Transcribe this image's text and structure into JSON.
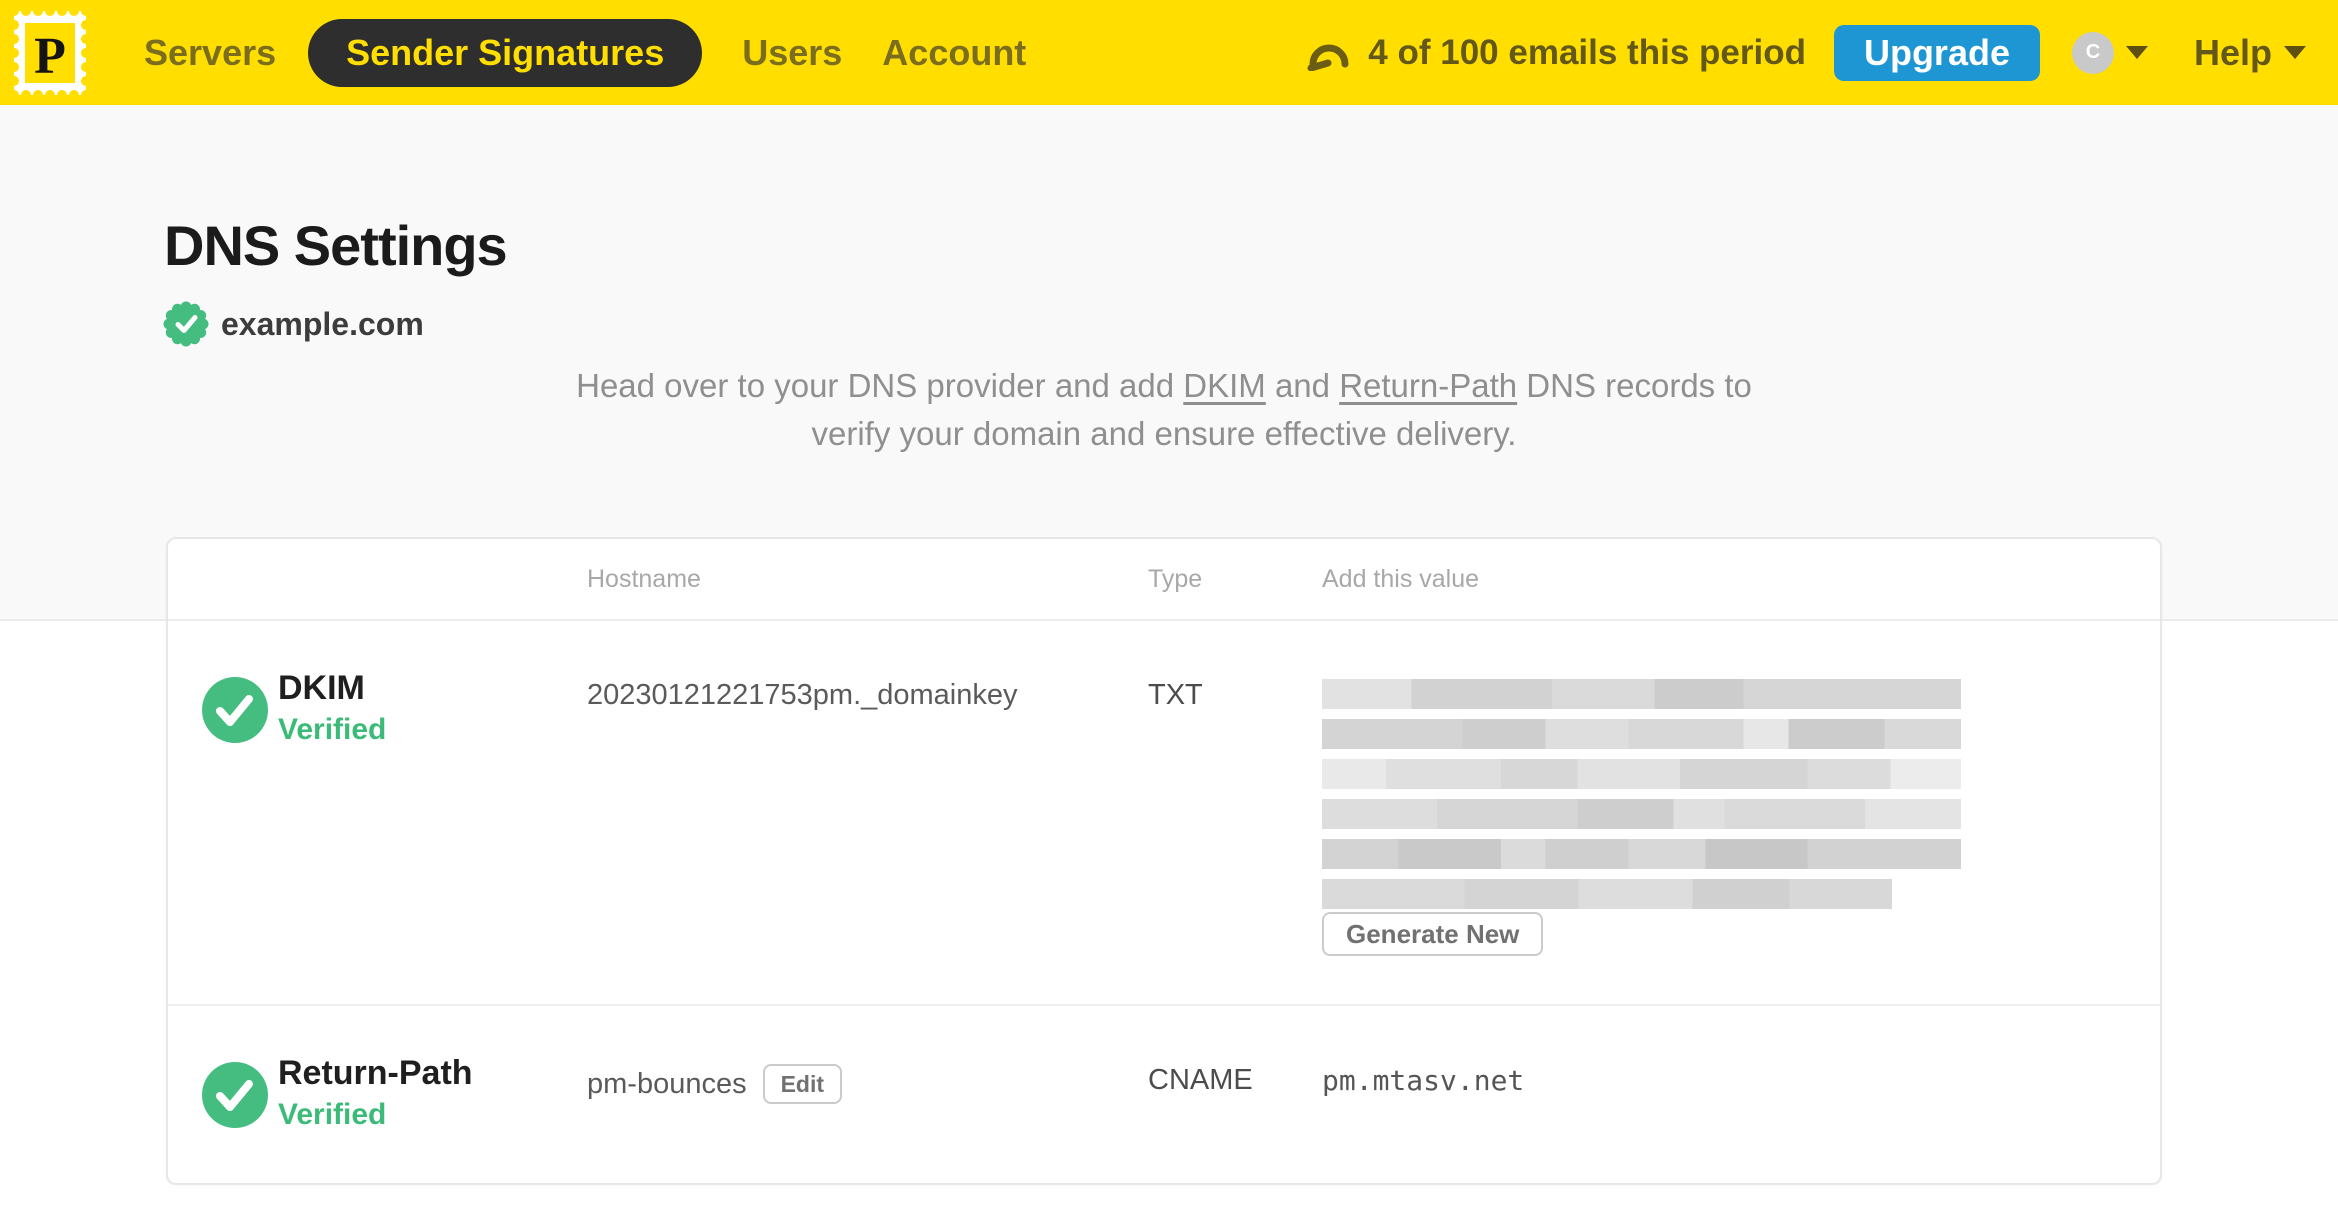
{
  "nav": {
    "logo_letter": "P",
    "items": [
      {
        "label": "Servers",
        "active": false
      },
      {
        "label": "Sender Signatures",
        "active": true
      },
      {
        "label": "Users",
        "active": false
      },
      {
        "label": "Account",
        "active": false
      }
    ],
    "usage_text": "4 of 100 emails this period",
    "upgrade_label": "Upgrade",
    "avatar_initial": "C",
    "help_label": "Help"
  },
  "page": {
    "title": "DNS Settings",
    "domain": "example.com",
    "intro": {
      "part1": "Head over to your DNS provider and add ",
      "link_dkim": "DKIM",
      "part2": " and ",
      "link_return_path": "Return-Path",
      "part3": " DNS records to",
      "line2": "verify your domain and ensure effective delivery."
    }
  },
  "table": {
    "headers": [
      "Hostname",
      "Type",
      "Add this value"
    ],
    "rows": [
      {
        "name": "DKIM",
        "status": "Verified",
        "hostname": "20230121221753pm._domainkey",
        "type": "TXT",
        "value_redacted": true,
        "redacted_line_count": 6,
        "action_label": "Generate New"
      },
      {
        "name": "Return-Path",
        "status": "Verified",
        "hostname": "pm-bounces",
        "edit_label": "Edit",
        "type": "CNAME",
        "value": "pm.mtasv.net"
      }
    ]
  },
  "colors": {
    "brand_yellow": "#FFDE00",
    "active_pill_dark": "#2E2E2E",
    "nav_text_olive": "#7A6D1E",
    "upgrade_blue": "#1E96D4",
    "verified_green": "#46BD80",
    "intro_gray": "#8F8F8F"
  }
}
